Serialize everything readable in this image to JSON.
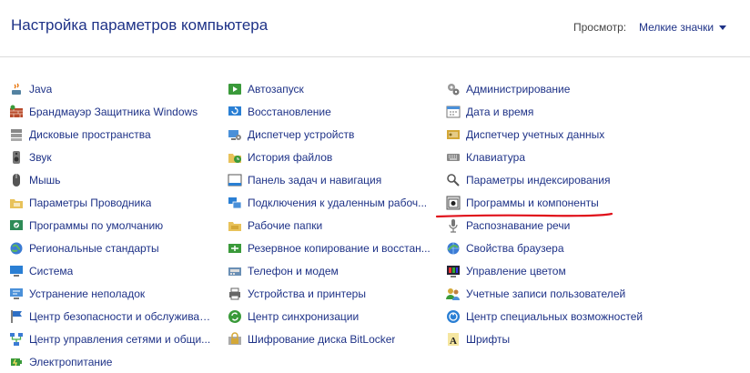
{
  "header": {
    "title": "Настройка параметров компьютера",
    "view_label": "Просмотр:",
    "view_value": "Мелкие значки"
  },
  "columns": [
    [
      {
        "label": "Java",
        "icon": "java-icon"
      },
      {
        "label": "Брандмауэр Защитника Windows",
        "icon": "firewall-icon"
      },
      {
        "label": "Дисковые пространства",
        "icon": "storage-spaces-icon"
      },
      {
        "label": "Звук",
        "icon": "sound-icon"
      },
      {
        "label": "Мышь",
        "icon": "mouse-icon"
      },
      {
        "label": "Параметры Проводника",
        "icon": "folder-options-icon"
      },
      {
        "label": "Программы по умолчанию",
        "icon": "default-programs-icon"
      },
      {
        "label": "Региональные стандарты",
        "icon": "region-icon"
      },
      {
        "label": "Система",
        "icon": "system-icon"
      },
      {
        "label": "Устранение неполадок",
        "icon": "troubleshooting-icon"
      },
      {
        "label": "Центр безопасности и обслуживан...",
        "icon": "security-flag-icon"
      },
      {
        "label": "Центр управления сетями и общи...",
        "icon": "network-icon"
      },
      {
        "label": "Электропитание",
        "icon": "power-icon"
      }
    ],
    [
      {
        "label": "Автозапуск",
        "icon": "autoplay-icon"
      },
      {
        "label": "Восстановление",
        "icon": "recovery-icon"
      },
      {
        "label": "Диспетчер устройств",
        "icon": "device-manager-icon"
      },
      {
        "label": "История файлов",
        "icon": "file-history-icon"
      },
      {
        "label": "Панель задач и навигация",
        "icon": "taskbar-icon"
      },
      {
        "label": "Подключения к удаленным рабоч...",
        "icon": "remote-desktop-icon"
      },
      {
        "label": "Рабочие папки",
        "icon": "work-folders-icon"
      },
      {
        "label": "Резервное копирование и восстан...",
        "icon": "backup-icon"
      },
      {
        "label": "Телефон и модем",
        "icon": "phone-modem-icon"
      },
      {
        "label": "Устройства и принтеры",
        "icon": "devices-printers-icon"
      },
      {
        "label": "Центр синхронизации",
        "icon": "sync-center-icon"
      },
      {
        "label": "Шифрование диска BitLocker",
        "icon": "bitlocker-icon"
      }
    ],
    [
      {
        "label": "Администрирование",
        "icon": "admin-tools-icon"
      },
      {
        "label": "Дата и время",
        "icon": "date-time-icon"
      },
      {
        "label": "Диспетчер учетных данных",
        "icon": "credential-manager-icon"
      },
      {
        "label": "Клавиатура",
        "icon": "keyboard-icon"
      },
      {
        "label": "Параметры индексирования",
        "icon": "indexing-icon"
      },
      {
        "label": "Программы и компоненты",
        "icon": "programs-features-icon"
      },
      {
        "label": "Распознавание речи",
        "icon": "microphone-icon"
      },
      {
        "label": "Свойства браузера",
        "icon": "internet-options-icon"
      },
      {
        "label": "Управление цветом",
        "icon": "color-management-icon"
      },
      {
        "label": "Учетные записи пользователей",
        "icon": "user-accounts-icon"
      },
      {
        "label": "Центр специальных возможностей",
        "icon": "ease-of-access-icon"
      },
      {
        "label": "Шрифты",
        "icon": "fonts-icon"
      }
    ]
  ],
  "highlight_color": "#e0101a",
  "link_color": "#1e3287"
}
